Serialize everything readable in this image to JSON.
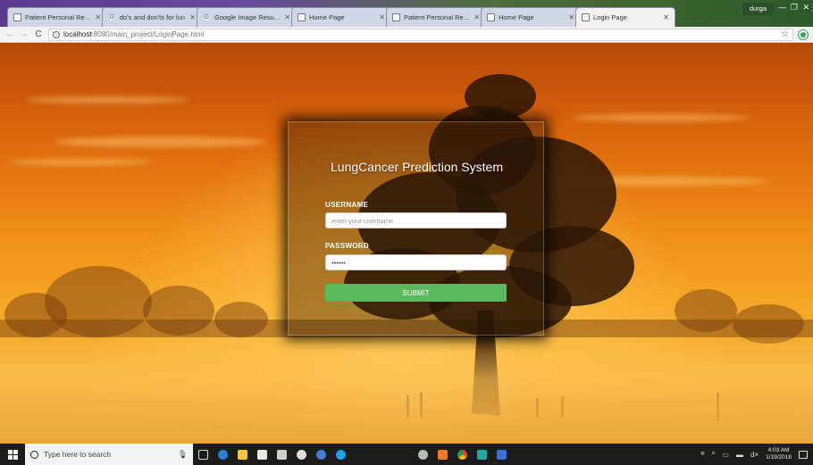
{
  "browser": {
    "tabs": [
      {
        "title": "Patient Personal Regist",
        "icon": "doc-icon",
        "active": false
      },
      {
        "title": "do's and don'ts for lun",
        "icon": "google-icon",
        "active": false
      },
      {
        "title": "Google Image Result fo",
        "icon": "google-icon",
        "active": false
      },
      {
        "title": "Home Page",
        "icon": "doc-icon",
        "active": false
      },
      {
        "title": "Patient Personal Regist",
        "icon": "doc-icon",
        "active": false
      },
      {
        "title": "Home Page",
        "icon": "doc-icon",
        "active": false
      },
      {
        "title": "Login Page",
        "icon": "doc-icon",
        "active": true
      }
    ],
    "profile_name": "durga",
    "url_host": "localhost",
    "url_path": ":8080/main_project/LoginPage.html"
  },
  "login": {
    "title": "LungCancer Prediction System",
    "username_label": "USERNAME",
    "username_placeholder": "enter your username",
    "password_label": "PASSWORD",
    "password_value": "••••••",
    "submit_label": "SUBMIT"
  },
  "taskbar": {
    "search_placeholder": "Type here to search",
    "time": "4:03 AM",
    "date": "1/19/2018"
  },
  "colors": {
    "submit_green": "#5cb85c",
    "sky_orange": "#ee8a16"
  }
}
